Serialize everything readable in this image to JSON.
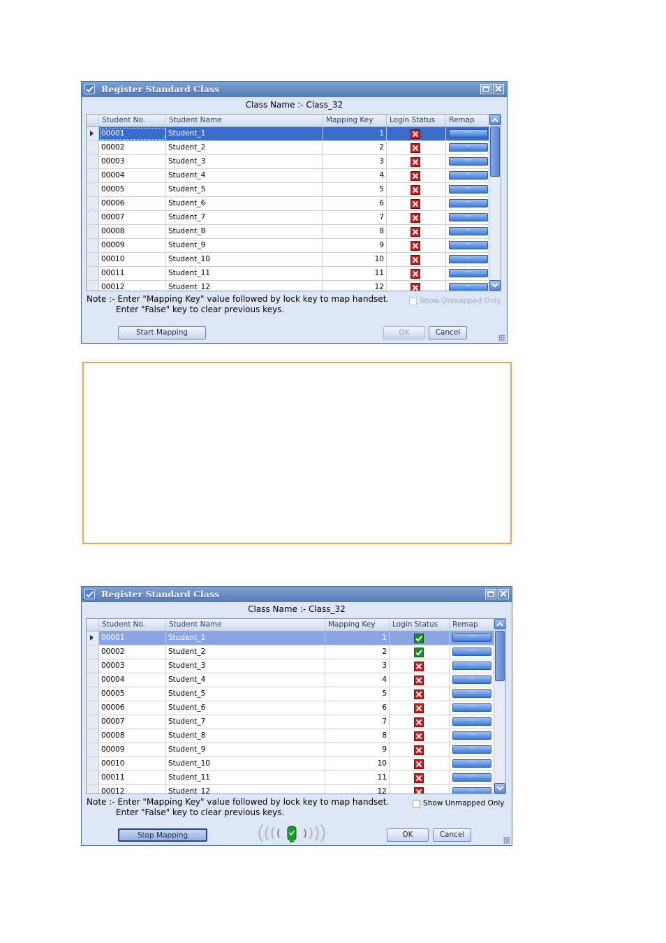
{
  "colors": {
    "titlebar": "#5f84c2",
    "selected_row": "#3b6cc9",
    "status_bad": "#c81e1e",
    "status_good": "#1e8f2a",
    "annotation_border": "#f0a050"
  },
  "windows": [
    {
      "title": "Register Standard Class",
      "class_name": "Class Name :- Class_32",
      "columns": [
        "Student No.",
        "Student Name",
        "Mapping Key",
        "Login Status",
        "Remap"
      ],
      "rows": [
        {
          "no": "00001",
          "name": "Student_1",
          "key": "1",
          "status": "cross-icon",
          "remap": "···"
        },
        {
          "no": "00002",
          "name": "Student_2",
          "key": "2",
          "status": "cross-icon",
          "remap": "···"
        },
        {
          "no": "00003",
          "name": "Student_3",
          "key": "3",
          "status": "cross-icon",
          "remap": "···"
        },
        {
          "no": "00004",
          "name": "Student_4",
          "key": "4",
          "status": "cross-icon",
          "remap": "···"
        },
        {
          "no": "00005",
          "name": "Student_5",
          "key": "5",
          "status": "cross-icon",
          "remap": "···"
        },
        {
          "no": "00006",
          "name": "Student_6",
          "key": "6",
          "status": "cross-icon",
          "remap": "···"
        },
        {
          "no": "00007",
          "name": "Student_7",
          "key": "7",
          "status": "cross-icon",
          "remap": "···"
        },
        {
          "no": "00008",
          "name": "Student_8",
          "key": "8",
          "status": "cross-icon",
          "remap": "···"
        },
        {
          "no": "00009",
          "name": "Student_9",
          "key": "9",
          "status": "cross-icon",
          "remap": "···"
        },
        {
          "no": "00010",
          "name": "Student_10",
          "key": "10",
          "status": "cross-icon",
          "remap": "···"
        },
        {
          "no": "00011",
          "name": "Student_11",
          "key": "11",
          "status": "cross-icon",
          "remap": "···"
        },
        {
          "no": "00012",
          "name": "Student_12",
          "key": "12",
          "status": "cross-icon",
          "remap": "···"
        }
      ],
      "note": "Note :- Enter \"Mapping Key\" value followed by lock key to map handset.\n           Enter \"False\" key to clear previous keys.",
      "show_unmapped_label": "Show Unmapped Only",
      "start_button": "Start Mapping",
      "ok_button": "OK",
      "cancel_button": "Cancel"
    },
    {
      "title": "Register Standard Class",
      "class_name": "Class Name :- Class_32",
      "columns": [
        "Student No.",
        "Student Name",
        "Mapping Key",
        "Login Status",
        "Remap"
      ],
      "rows": [
        {
          "no": "00001",
          "name": "Student_1",
          "key": "1",
          "status": "check-icon",
          "remap": "···"
        },
        {
          "no": "00002",
          "name": "Student_2",
          "key": "2",
          "status": "check-icon",
          "remap": "···"
        },
        {
          "no": "00003",
          "name": "Student_3",
          "key": "3",
          "status": "cross-icon",
          "remap": "···"
        },
        {
          "no": "00004",
          "name": "Student_4",
          "key": "4",
          "status": "cross-icon",
          "remap": "···"
        },
        {
          "no": "00005",
          "name": "Student_5",
          "key": "5",
          "status": "cross-icon",
          "remap": "···"
        },
        {
          "no": "00006",
          "name": "Student_6",
          "key": "6",
          "status": "cross-icon",
          "remap": "···"
        },
        {
          "no": "00007",
          "name": "Student_7",
          "key": "7",
          "status": "cross-icon",
          "remap": "···"
        },
        {
          "no": "00008",
          "name": "Student_8",
          "key": "8",
          "status": "cross-icon",
          "remap": "···"
        },
        {
          "no": "00009",
          "name": "Student_9",
          "key": "9",
          "status": "cross-icon",
          "remap": "···"
        },
        {
          "no": "00010",
          "name": "Student_10",
          "key": "10",
          "status": "cross-icon",
          "remap": "···"
        },
        {
          "no": "00011",
          "name": "Student_11",
          "key": "11",
          "status": "cross-icon",
          "remap": "···"
        },
        {
          "no": "00012",
          "name": "Student_12",
          "key": "12",
          "status": "cross-icon",
          "remap": "···"
        }
      ],
      "note": "Note :- Enter \"Mapping Key\" value followed by lock key to map handset.\n           Enter \"False\" key to clear previous keys.",
      "show_unmapped_label": "Show Unmapped Only",
      "stop_button": "Stop Mapping",
      "ok_button": "OK",
      "cancel_button": "Cancel",
      "signal_icon": "wireless-handset-icon"
    }
  ]
}
